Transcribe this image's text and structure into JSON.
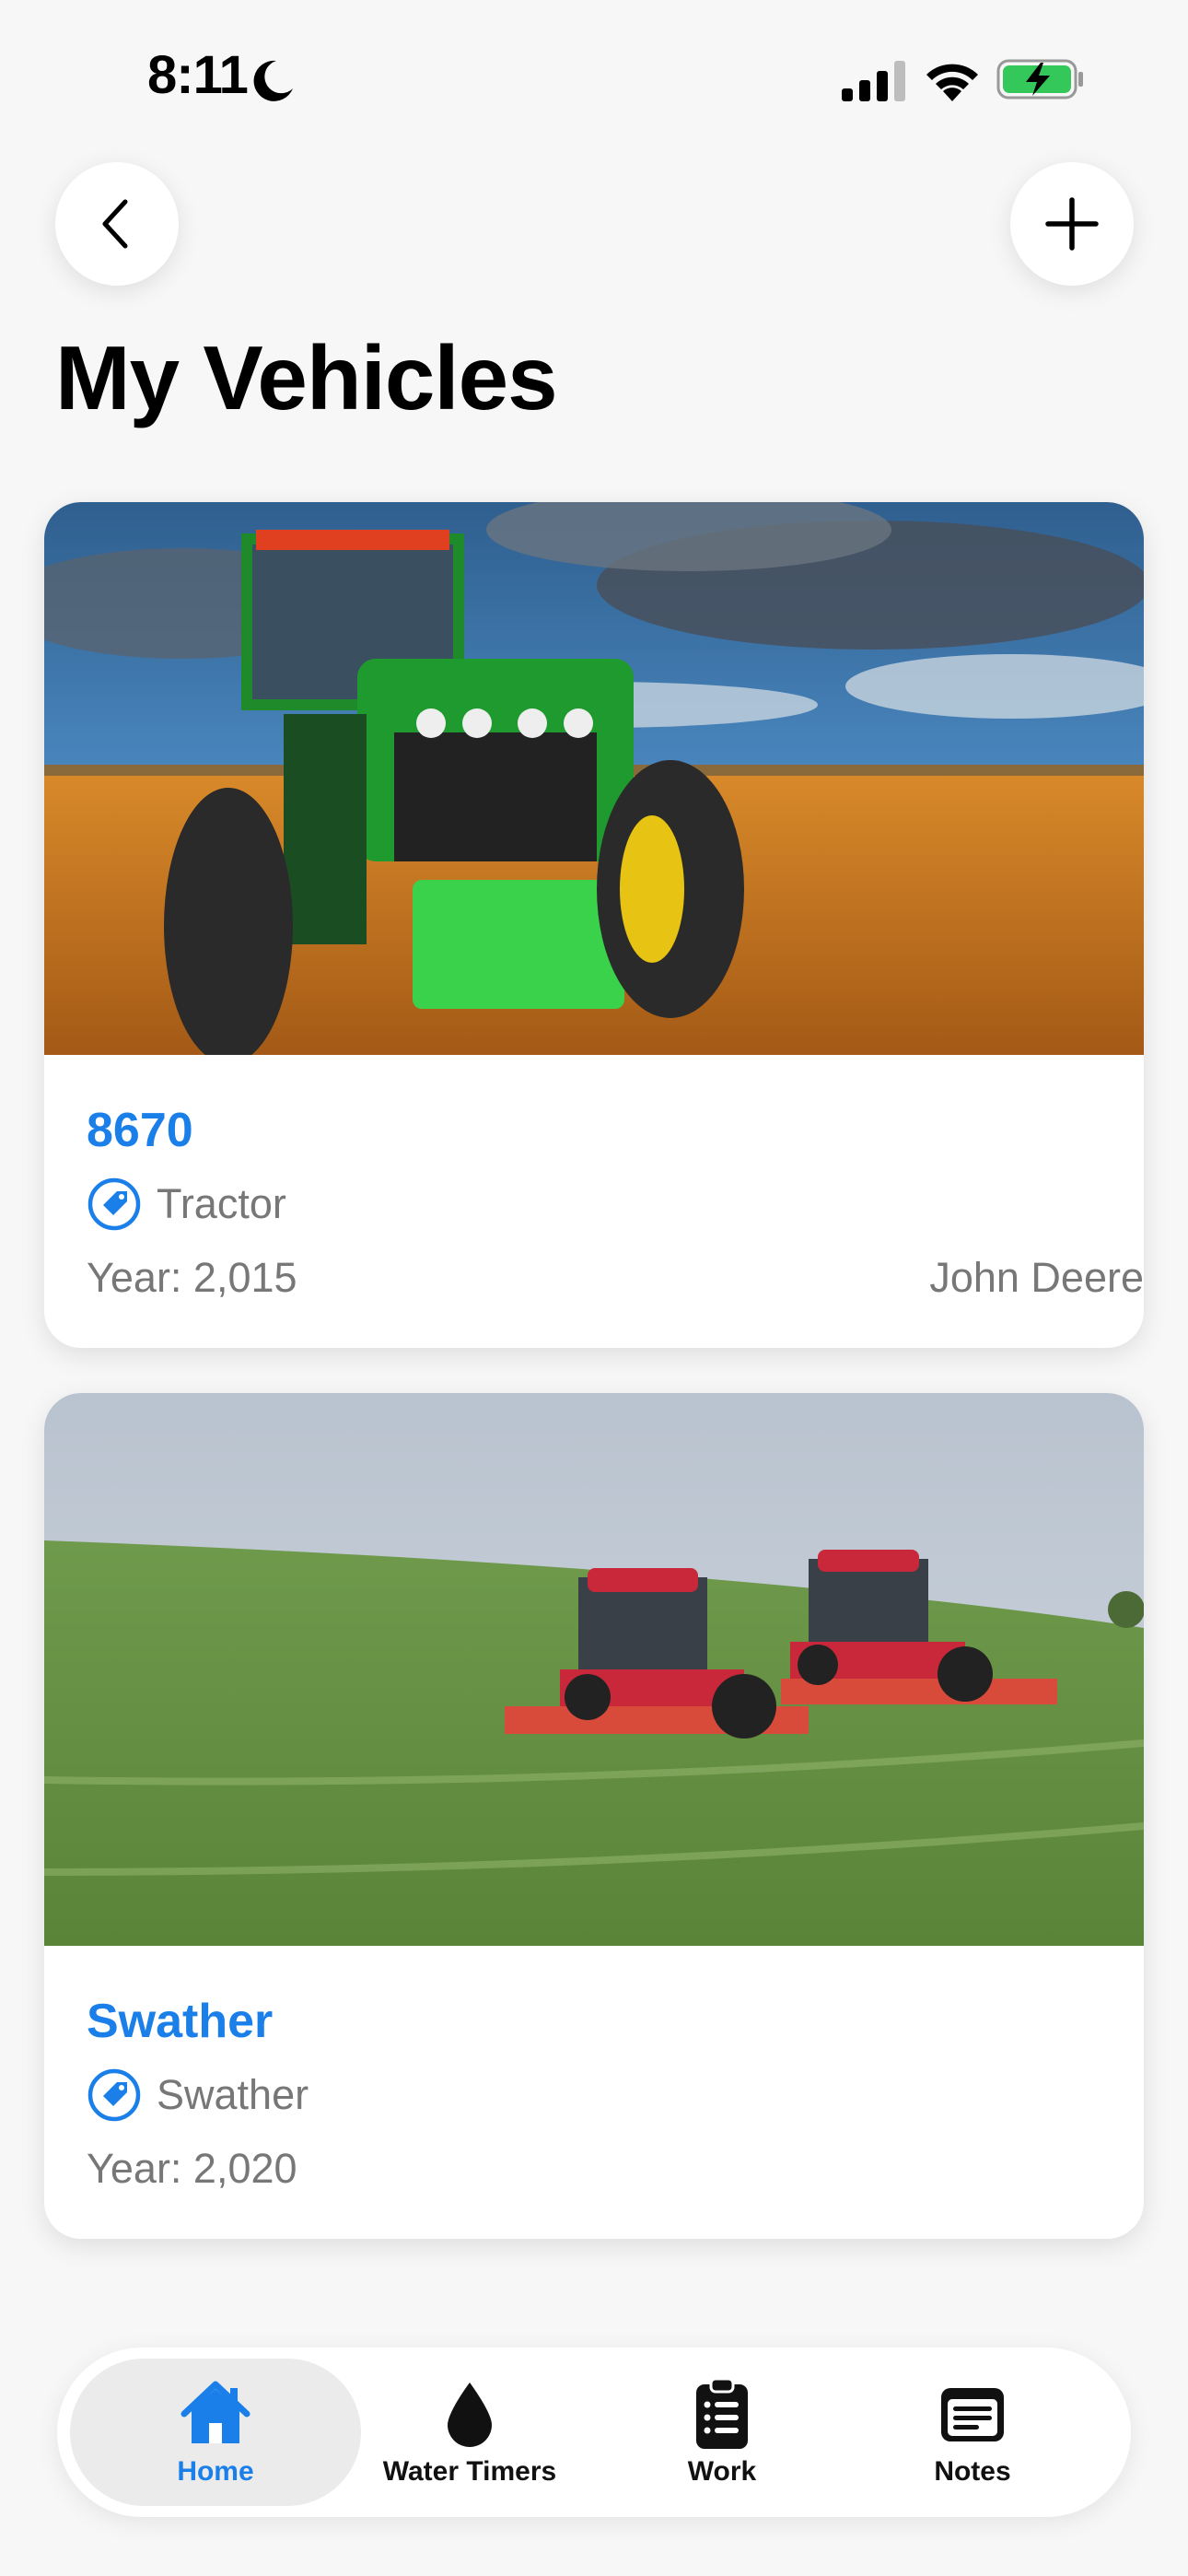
{
  "status_bar": {
    "time": "8:11",
    "icons": [
      "moon-icon",
      "cellular-signal-icon",
      "wifi-icon",
      "battery-charging-icon"
    ],
    "battery_color": "#34c759"
  },
  "nav": {
    "back_icon": "chevron-left-icon",
    "add_icon": "plus-icon"
  },
  "page": {
    "title": "My Vehicles"
  },
  "colors": {
    "accent": "#1a7fe8",
    "secondary_text": "#777777",
    "background": "#f7f7f7"
  },
  "vehicles": [
    {
      "name": "8670",
      "type": "Tractor",
      "year": "Year: 2,015",
      "make": "John Deere",
      "image": "green-tractor-in-harvested-field-photo"
    },
    {
      "name": "Swather",
      "type": "Swather",
      "year": "Year: 2,020",
      "image": "two-red-swathers-in-green-field-photo"
    }
  ],
  "tabs": [
    {
      "label": "Home",
      "icon": "house-icon",
      "active": true
    },
    {
      "label": "Water Timers",
      "icon": "water-drop-icon",
      "active": false
    },
    {
      "label": "Work",
      "icon": "clipboard-list-icon",
      "active": false
    },
    {
      "label": "Notes",
      "icon": "notes-icon",
      "active": false
    }
  ]
}
